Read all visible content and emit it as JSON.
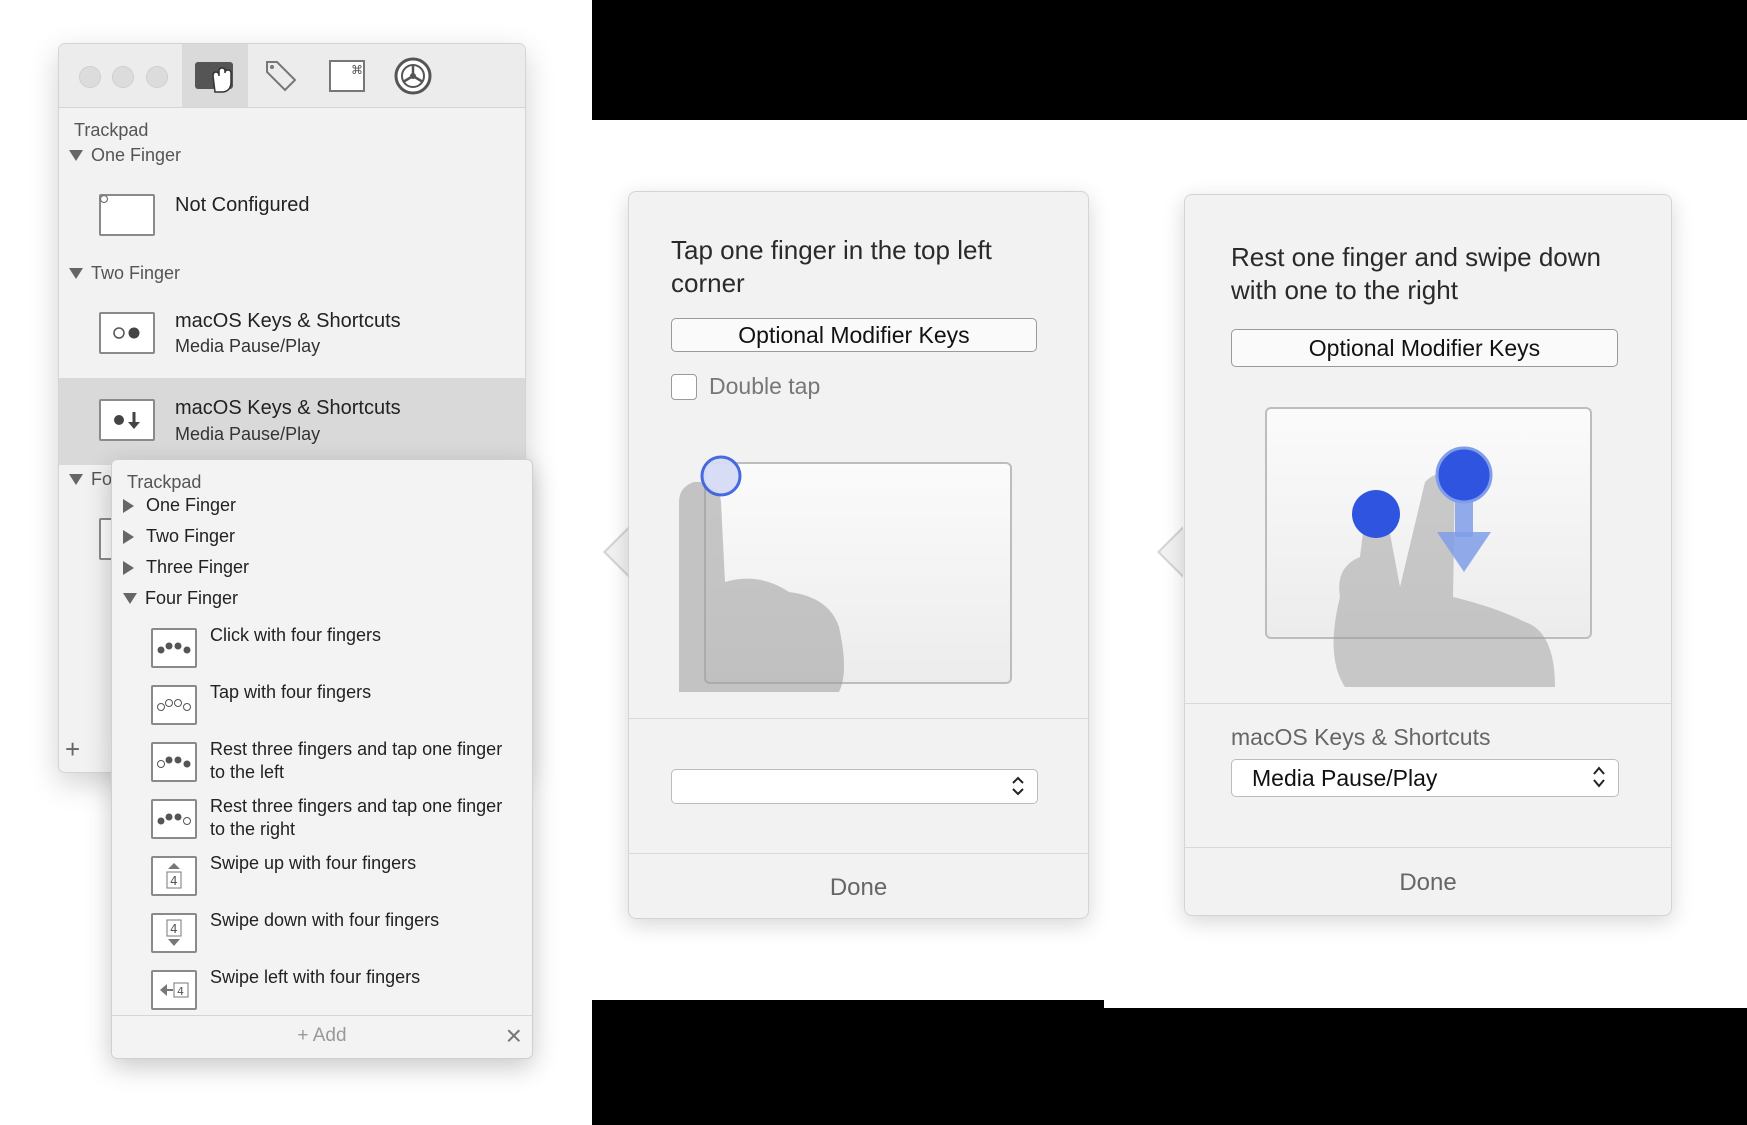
{
  "main_window": {
    "section_label": "Trackpad",
    "groups": {
      "one_finger": "One Finger",
      "two_finger": "Two Finger",
      "four_finger_partial": "Fo"
    },
    "items": [
      {
        "title": "Not Configured",
        "subtitle": ""
      },
      {
        "title": "macOS Keys & Shortcuts",
        "subtitle": "Media Pause/Play"
      },
      {
        "title": "macOS Keys & Shortcuts",
        "subtitle": "Media Pause/Play"
      }
    ],
    "add_symbol": "+"
  },
  "add_popover": {
    "section_label": "Trackpad",
    "groups": [
      "One Finger",
      "Two Finger",
      "Three Finger",
      "Four Finger"
    ],
    "items": [
      "Click with four fingers",
      "Tap with four fingers",
      "Rest three fingers and tap one finger to the left",
      "Rest three fingers and tap one finger to the right",
      "Swipe up with four fingers",
      "Swipe down with four fingers",
      "Swipe left with four fingers"
    ],
    "add_label": "+ Add",
    "close_symbol": "×"
  },
  "panel_tap": {
    "title": "Tap one finger in the top left corner",
    "modifier_button": "Optional Modifier Keys",
    "double_tap_label": "Double tap",
    "double_tap_checked": false,
    "select_value": "",
    "done_label": "Done"
  },
  "panel_swipe": {
    "title": "Rest one finger and swipe down with one to the right",
    "modifier_button": "Optional Modifier Keys",
    "action_category": "macOS Keys & Shortcuts",
    "select_value": "Media Pause/Play",
    "done_label": "Done"
  },
  "icons": {
    "toolbar": [
      "trackpad-gesture-icon",
      "tag-icon",
      "command-key-icon",
      "gear-icon"
    ],
    "touch_accent": "#3d63e0"
  }
}
